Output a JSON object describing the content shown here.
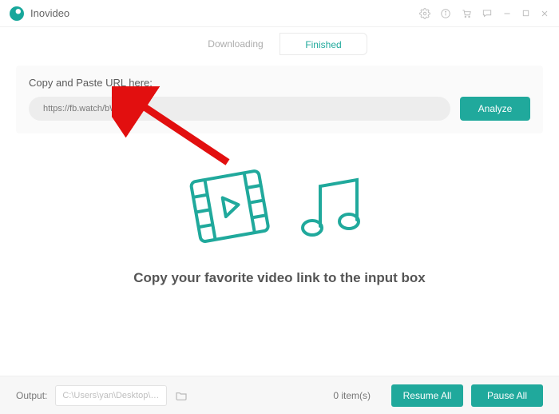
{
  "app": {
    "title": "Inovideo"
  },
  "tabs": {
    "downloading": "Downloading",
    "finished": "Finished"
  },
  "panel": {
    "label": "Copy and Paste URL here:",
    "url_value": "https://fb.watch/bWxM93...",
    "analyze": "Analyze"
  },
  "center": {
    "caption": "Copy your favorite video link to the input box"
  },
  "footer": {
    "output_label": "Output:",
    "path": "C:\\Users\\yan\\Desktop\\te...",
    "items": "0 item(s)",
    "resume": "Resume All",
    "pause": "Pause All"
  }
}
